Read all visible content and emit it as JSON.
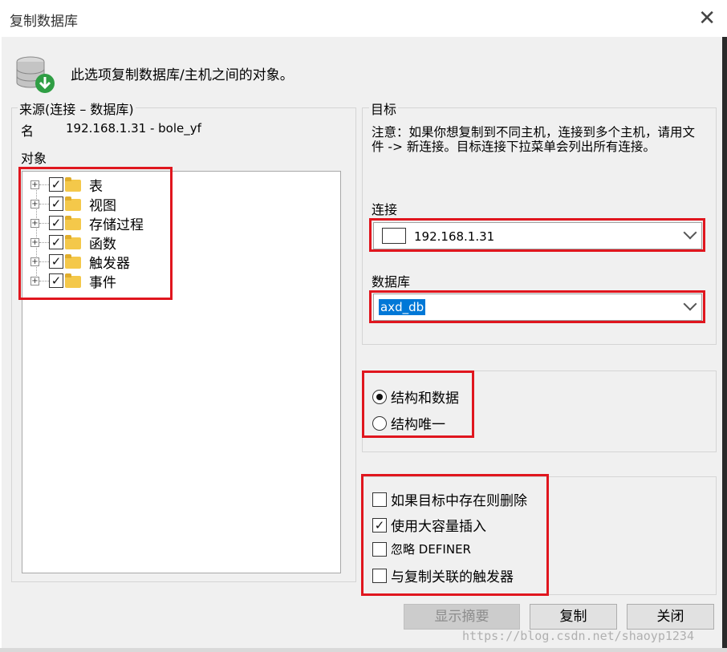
{
  "window": {
    "title": "复制数据库",
    "close_glyph": "✕"
  },
  "header": {
    "description": "此选项复制数据库/主机之间的对象。",
    "icon": "database-copy-icon"
  },
  "source": {
    "legend": "来源(连接 – 数据库)",
    "name_label": "名",
    "name_value": "192.168.1.31 - bole_yf",
    "objects_label": "对象",
    "tree_items": [
      {
        "label": "表",
        "checked": "✓"
      },
      {
        "label": "视图",
        "checked": "✓"
      },
      {
        "label": "存储过程",
        "checked": "✓"
      },
      {
        "label": "函数",
        "checked": "✓"
      },
      {
        "label": "触发器",
        "checked": "✓"
      },
      {
        "label": "事件",
        "checked": "✓"
      }
    ]
  },
  "target": {
    "legend": "目标",
    "note": "注意：如果你想复制到不同主机，连接到多个主机，请用文件 -> 新连接。目标连接下拉菜单会列出所有连接。",
    "connection_label": "连接",
    "connection_value": "192.168.1.31",
    "database_label": "数据库",
    "database_value": "axd_db"
  },
  "mode": {
    "options": [
      {
        "label": "结构和数据",
        "selected": true
      },
      {
        "label": "结构唯一",
        "selected": false
      }
    ]
  },
  "settings": {
    "options": [
      {
        "label": "如果目标中存在则删除",
        "checked": ""
      },
      {
        "label": "使用大容量插入",
        "checked": "✓"
      },
      {
        "label": "忽略 DEFINER",
        "checked": ""
      },
      {
        "label": "与复制关联的触发器",
        "checked": ""
      }
    ]
  },
  "buttons": {
    "summary": "显示摘要",
    "copy": "复制",
    "close": "关闭"
  },
  "watermark": "https://blog.csdn.net/shaoyp1234",
  "colors": {
    "highlight": "#e0161e",
    "selection": "#0078d7"
  }
}
